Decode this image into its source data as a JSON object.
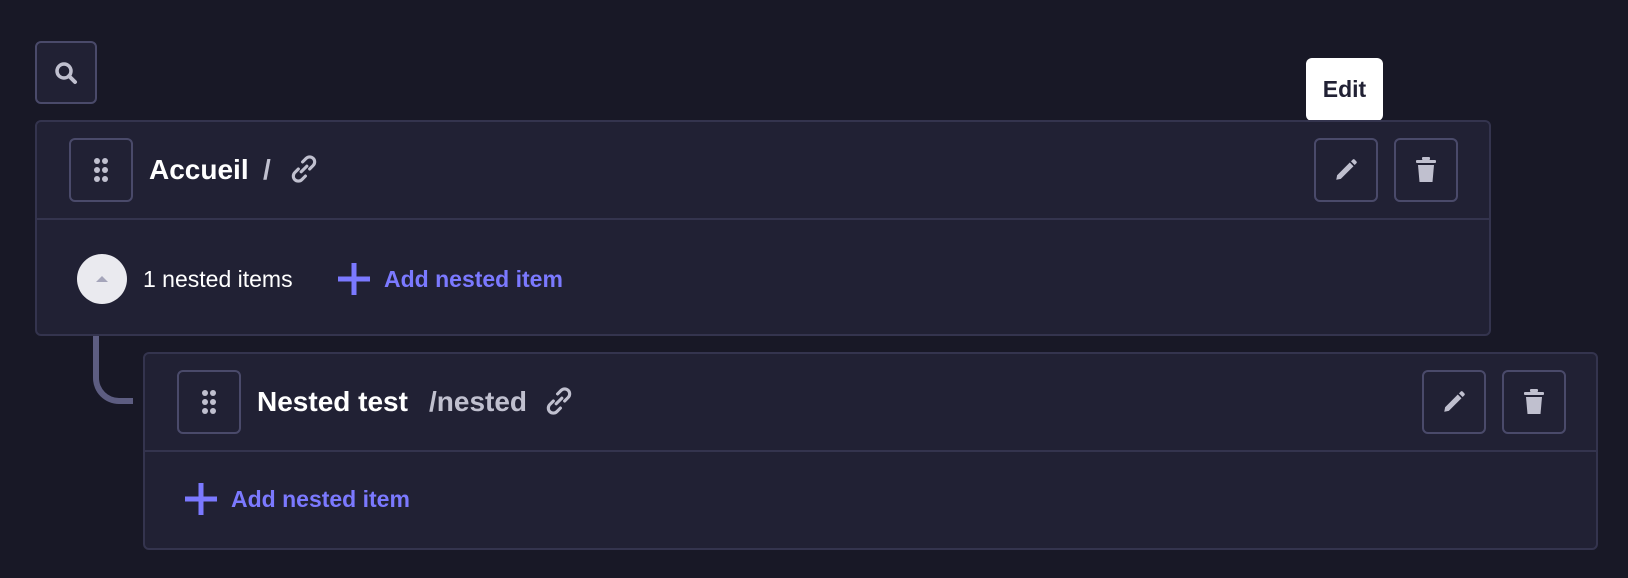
{
  "toolbar": {
    "search_icon": "search-icon"
  },
  "tooltip": {
    "text": "Edit"
  },
  "items": [
    {
      "title": "Accueil",
      "path": "/",
      "nested_count_text": "1 nested items",
      "add_nested_label": "Add nested item"
    },
    {
      "title": "Nested test",
      "path": "/nested",
      "add_nested_label": "Add nested item"
    }
  ],
  "colors": {
    "background": "#181826",
    "card": "#212134",
    "border": "#34344e",
    "accent": "#7b79ff",
    "connector": "#5d5d81"
  }
}
